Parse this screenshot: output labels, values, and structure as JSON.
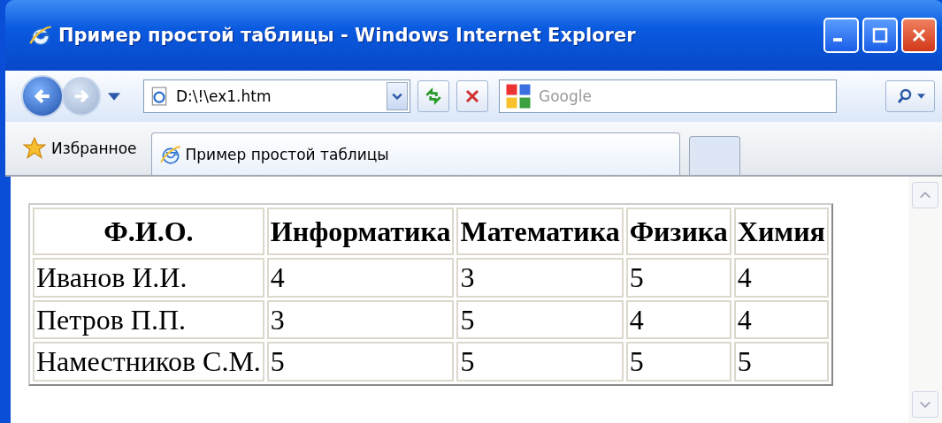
{
  "window": {
    "title": "Пример простой таблицы - Windows Internet Explorer"
  },
  "address_bar": {
    "value": "D:\\!\\ex1.htm"
  },
  "search": {
    "placeholder": "Google"
  },
  "favorites": {
    "label": "Избранное"
  },
  "tabs": [
    {
      "label": "Пример простой таблицы",
      "selected": true
    }
  ],
  "table": {
    "columns": [
      "Ф.И.О.",
      "Информатика",
      "Математика",
      "Физика",
      "Химия"
    ],
    "rows": [
      [
        "Иванов И.И.",
        "4",
        "3",
        "5",
        "4"
      ],
      [
        "Петров П.П.",
        "3",
        "5",
        "4",
        "4"
      ],
      [
        "Наместников С.М.",
        "5",
        "5",
        "5",
        "5"
      ]
    ]
  }
}
